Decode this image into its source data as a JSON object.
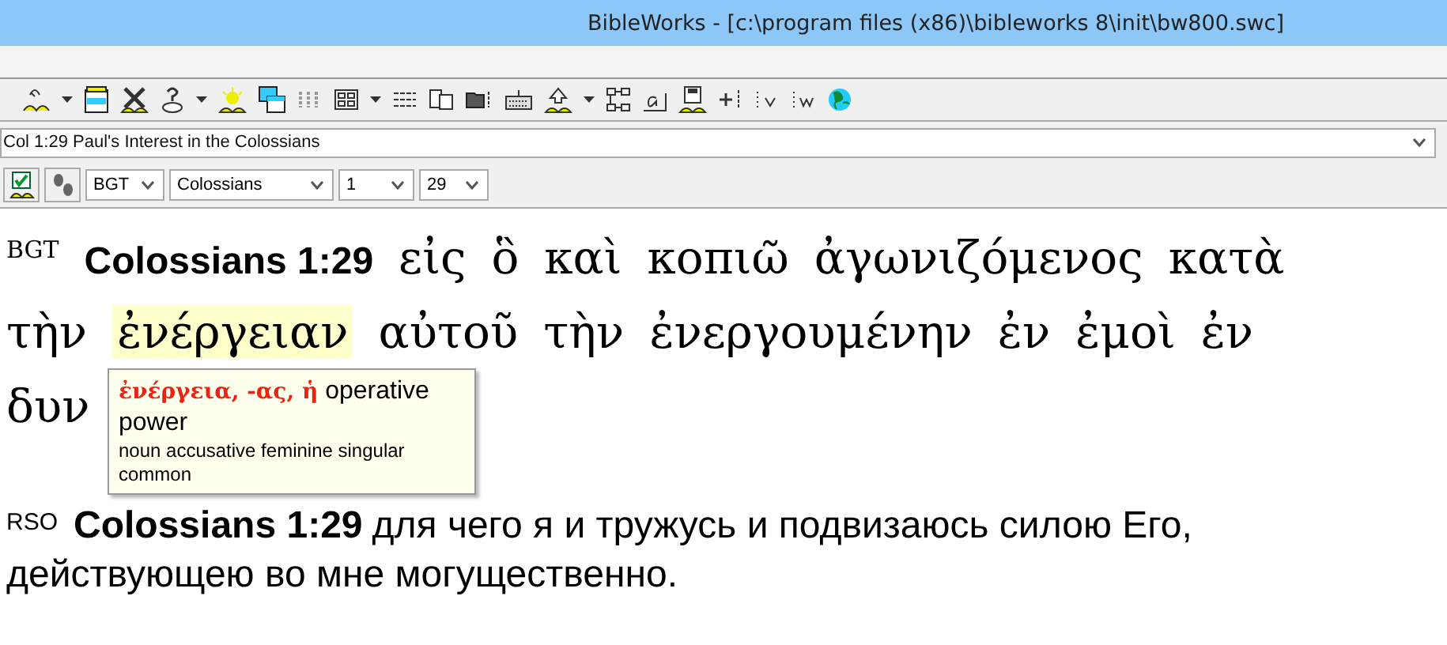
{
  "window": {
    "title": "BibleWorks - [c:\\program files (x86)\\bibleworks 8\\init\\bw800.swc]"
  },
  "reference_box": {
    "value": "Col 1:29 Paul's Interest in the Colossians"
  },
  "nav": {
    "version": "BGT",
    "book": "Colossians",
    "chapter": "1",
    "verse": "29",
    "filter_checked": true
  },
  "verses": [
    {
      "version": "BGT",
      "reference": "Colossians 1:29",
      "kind": "greek",
      "lines": [
        [
          {
            "text": "εἰς",
            "selected": false
          },
          {
            "text": "ὃ",
            "selected": false
          },
          {
            "text": "καὶ",
            "selected": false
          },
          {
            "text": "κοπιῶ",
            "selected": false
          },
          {
            "text": "ἀγωνιζόμενος",
            "selected": false
          },
          {
            "text": "κατὰ",
            "selected": false
          }
        ],
        [
          {
            "text": "τὴν",
            "selected": false
          },
          {
            "text": "ἐνέργειαν",
            "selected": true
          },
          {
            "text": "αὐτοῦ",
            "selected": false
          },
          {
            "text": "τὴν",
            "selected": false
          },
          {
            "text": "ἐνεργουμένην",
            "selected": false
          },
          {
            "text": "ἐν",
            "selected": false
          },
          {
            "text": "ἐμοὶ",
            "selected": false
          },
          {
            "text": "ἐν",
            "selected": false
          }
        ],
        [
          {
            "text": "δυν",
            "selected": false
          }
        ]
      ]
    },
    {
      "version": "RSO",
      "reference": "Colossians 1:29",
      "kind": "plain",
      "lines": [
        [
          {
            "text": "для чего я и тружусь и подвизаюсь силою Его,",
            "selected": false
          }
        ],
        [
          {
            "text": "действующею во мне могущественно.",
            "selected": false
          }
        ]
      ]
    }
  ],
  "tooltip": {
    "definition": "**ἐνέργεια, -ας, ἡ** operative power",
    "parsing": "noun accusative feminine singular common"
  }
}
